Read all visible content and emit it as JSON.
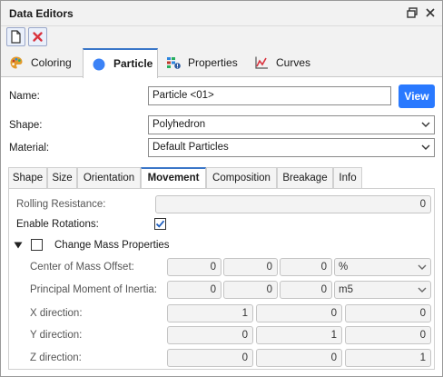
{
  "window": {
    "title": "Data Editors"
  },
  "main_tabs": [
    {
      "label": "Coloring"
    },
    {
      "label": "Particle"
    },
    {
      "label": "Properties"
    },
    {
      "label": "Curves"
    }
  ],
  "form": {
    "name_label": "Name:",
    "name_value": "Particle <01>",
    "view_label": "View",
    "shape_label": "Shape:",
    "shape_value": "Polyhedron",
    "material_label": "Material:",
    "material_value": "Default Particles"
  },
  "sub_tabs": [
    {
      "label": "Shape"
    },
    {
      "label": "Size"
    },
    {
      "label": "Orientation"
    },
    {
      "label": "Movement"
    },
    {
      "label": "Composition"
    },
    {
      "label": "Breakage"
    },
    {
      "label": "Info"
    }
  ],
  "movement": {
    "rolling_resistance_label": "Rolling Resistance:",
    "rolling_resistance_value": "0",
    "enable_rotations_label": "Enable Rotations:",
    "enable_rotations_checked": true,
    "change_mass_label": "Change Mass Properties",
    "change_mass_checked": false,
    "com_offset_label": "Center of Mass Offset:",
    "com_offset_values": [
      "0",
      "0",
      "0"
    ],
    "com_offset_unit": "%",
    "pmi_label": "Principal Moment of Inertia:",
    "pmi_values": [
      "0",
      "0",
      "0"
    ],
    "pmi_unit": "m5",
    "x_dir_label": "X direction:",
    "x_dir_values": [
      "1",
      "0",
      "0"
    ],
    "y_dir_label": "Y direction:",
    "y_dir_values": [
      "0",
      "1",
      "0"
    ],
    "z_dir_label": "Z direction:",
    "z_dir_values": [
      "0",
      "0",
      "1"
    ]
  },
  "colors": {
    "accent": "#2979ff",
    "tab_border": "#3a76c8",
    "close_red": "#d9333f"
  }
}
